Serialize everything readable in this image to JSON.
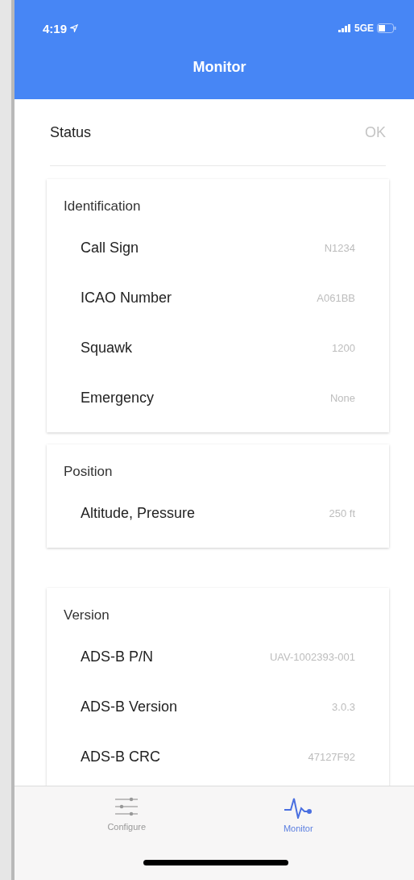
{
  "status_bar": {
    "time": "4:19",
    "network": "5GE"
  },
  "header": {
    "title": "Monitor"
  },
  "status": {
    "label": "Status",
    "value": "OK"
  },
  "cards": [
    {
      "title": "Identification",
      "rows": [
        {
          "label": "Call Sign",
          "value": "N1234"
        },
        {
          "label": "ICAO Number",
          "value": "A061BB"
        },
        {
          "label": "Squawk",
          "value": "1200"
        },
        {
          "label": "Emergency",
          "value": "None"
        }
      ]
    },
    {
      "title": "Position",
      "rows": [
        {
          "label": "Altitude, Pressure",
          "value": "250 ft"
        }
      ]
    },
    {
      "title": "Version",
      "rows": [
        {
          "label": "ADS-B P/N",
          "value": "UAV-1002393-001"
        },
        {
          "label": "ADS-B Version",
          "value": "3.0.3"
        },
        {
          "label": "ADS-B CRC",
          "value": "47127F92"
        }
      ]
    }
  ],
  "tabs": [
    {
      "label": "Configure",
      "kind": "sliders",
      "selected": false
    },
    {
      "label": "Monitor",
      "kind": "pulse",
      "selected": true
    }
  ]
}
